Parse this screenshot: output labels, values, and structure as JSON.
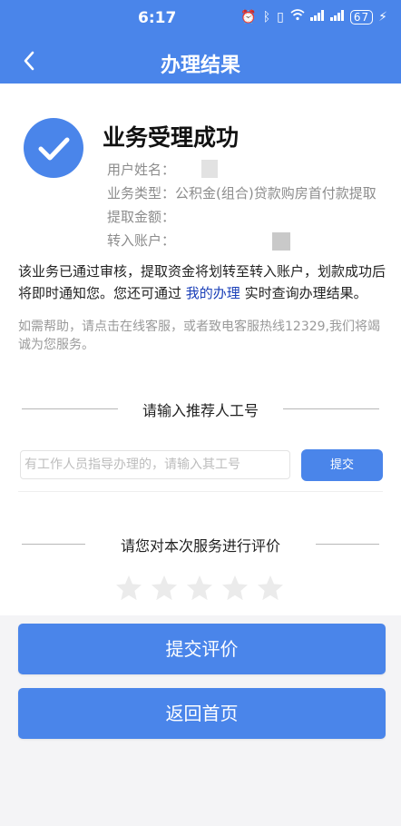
{
  "status_bar": {
    "time": "6:17",
    "icons": [
      "alarm-icon",
      "bluetooth-icon",
      "vibrate-icon",
      "wifi-icon",
      "signal-icon",
      "signal-icon"
    ],
    "battery": "67"
  },
  "header": {
    "title": "办理结果"
  },
  "result": {
    "title": "业务受理成功",
    "rows": [
      {
        "label": "用户姓名：",
        "value": ""
      },
      {
        "label": "业务类型：",
        "value": "公积金(组合)贷款购房首付款提取"
      },
      {
        "label": "提取金额：",
        "value": ""
      },
      {
        "label": "转入账户：",
        "value": ""
      }
    ]
  },
  "notice": {
    "text_before": "该业务已通过审核，提取资金将划转至转入账户，划款成功后将即时通知您。您还可通过 ",
    "link": "我的办理",
    "text_after": " 实时查询办理结果。"
  },
  "help": {
    "text": "如需帮助，请点击在线客服，或者致电客服热线12329,我们将竭诚为您服务。"
  },
  "referrer": {
    "heading": "请输入推荐人工号",
    "placeholder": "有工作人员指导办理的，请输入其工号",
    "value": "",
    "submit_label": "提交"
  },
  "rating": {
    "heading": "请您对本次服务进行评价",
    "stars_total": 5,
    "stars_selected": 0,
    "star_color": "#ebebeb"
  },
  "actions": {
    "submit_rating": "提交评价",
    "back_home": "返回首页"
  },
  "colors": {
    "primary": "#4a85ea",
    "link": "#1a3fb8"
  }
}
